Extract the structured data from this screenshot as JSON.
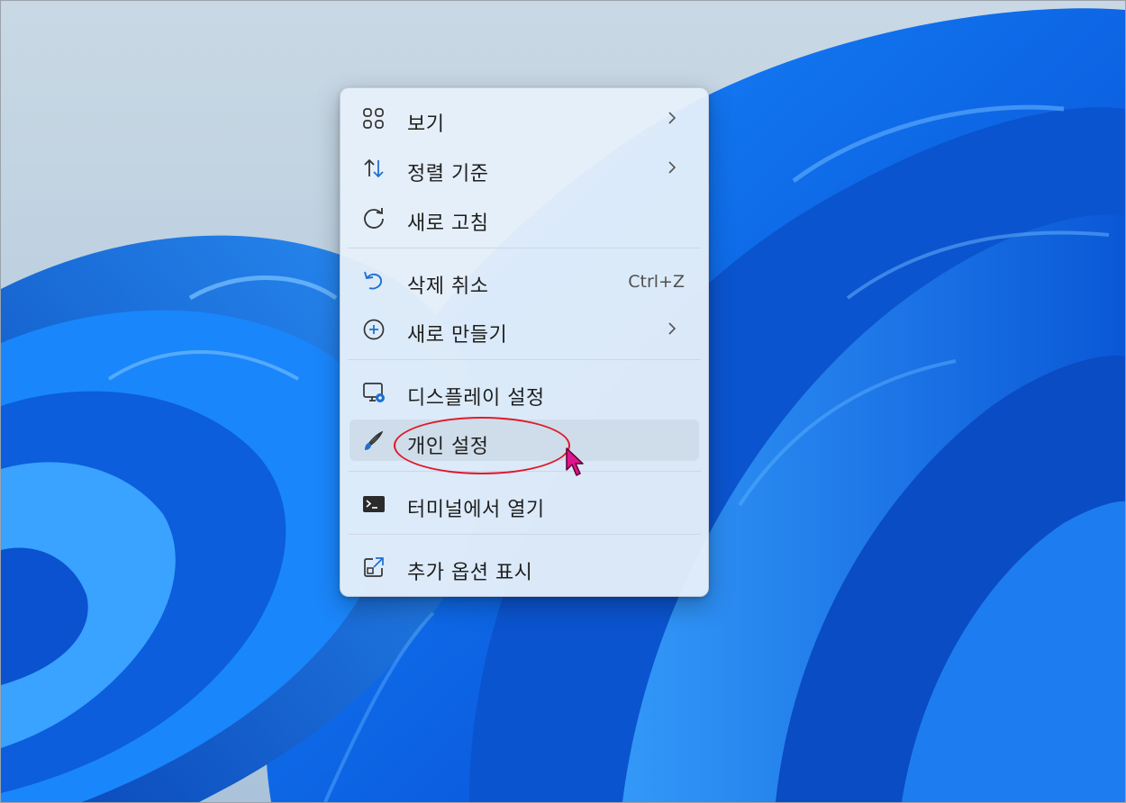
{
  "menu": {
    "items": [
      {
        "label": "보기",
        "icon": "grid-view-icon",
        "submenu": true
      },
      {
        "label": "정렬 기준",
        "icon": "sort-arrows-icon",
        "submenu": true
      },
      {
        "label": "새로 고침",
        "icon": "refresh-icon",
        "submenu": false
      },
      {
        "label": "삭제 취소",
        "icon": "undo-icon",
        "shortcut": "Ctrl+Z"
      },
      {
        "label": "새로 만들기",
        "icon": "plus-circle-icon",
        "submenu": true
      },
      {
        "label": "디스플레이 설정",
        "icon": "display-settings-icon",
        "submenu": false
      },
      {
        "label": "개인 설정",
        "icon": "brush-icon",
        "submenu": false,
        "highlighted": true
      },
      {
        "label": "터미널에서 열기",
        "icon": "terminal-icon",
        "submenu": false
      },
      {
        "label": "추가 옵션 표시",
        "icon": "open-external-icon",
        "submenu": false
      }
    ]
  },
  "colors": {
    "accent": "#1f6fd1",
    "annotation": "#e0192a",
    "cursor": "#e0148c",
    "wallpaper_blue": "#0a63e6"
  }
}
